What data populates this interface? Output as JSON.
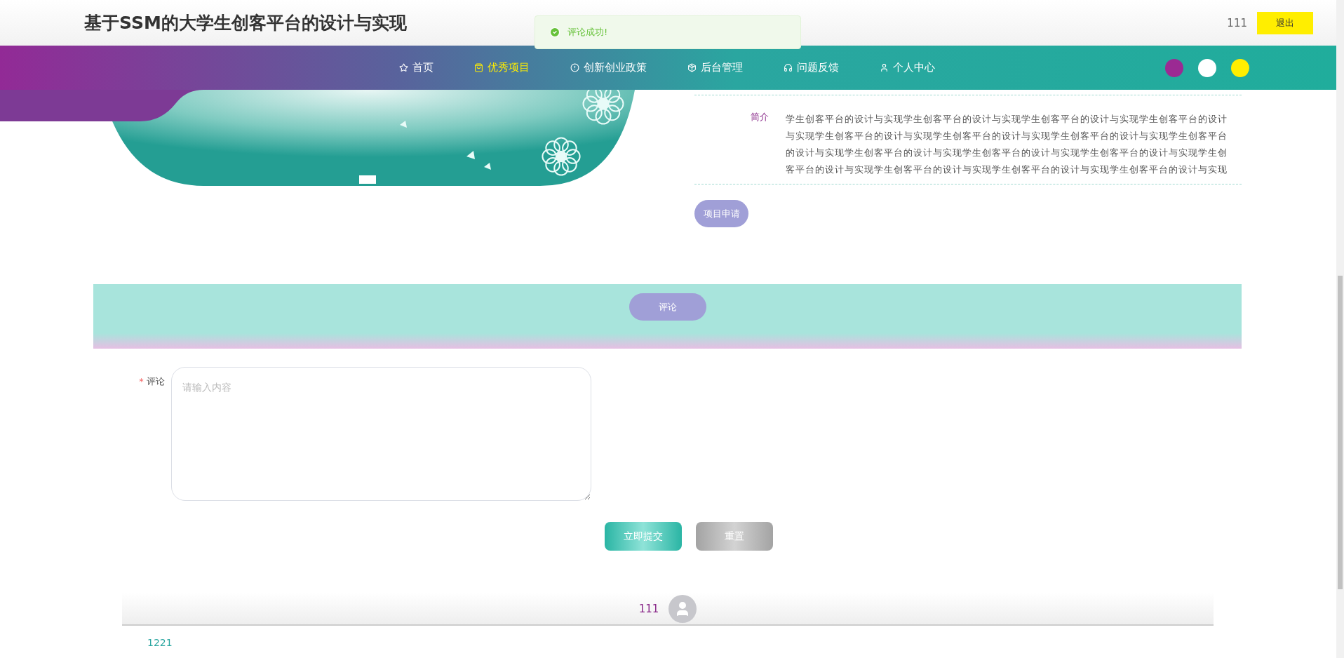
{
  "header": {
    "title": "基于SSM的大学生创客平台的设计与实现",
    "username": "111",
    "logout": "退出"
  },
  "toast": {
    "kind": "success",
    "message": "评论成功!"
  },
  "nav": {
    "items": [
      {
        "label": "首页",
        "selected": false
      },
      {
        "label": "优秀项目",
        "selected": true
      },
      {
        "label": "创新创业政策",
        "selected": false
      },
      {
        "label": "后台管理",
        "selected": false
      },
      {
        "label": "问题反馈",
        "selected": false
      },
      {
        "label": "个人中心",
        "selected": false
      }
    ]
  },
  "theme_dots": [
    {
      "color": "#9b2a93"
    },
    {
      "color": "#ffffff"
    },
    {
      "color": "#ffee00"
    }
  ],
  "project": {
    "fields": [
      {
        "label": "简介",
        "value": "学生创客平台的设计与实现学生创客平台的设计与实现学生创客平台的设计与实现学生创客平台的设计与实现学生创客平台的设计与实现学生创客平台的设计与实现学生创客平台的设计与实现学生创客平台的设计与实现学生创客平台的设计与实现学生创客平台的设计与实现学生创客平台的设计与实现学生创客平台的设计与实现学生创客平台的设计与实现学生创客平台的设计与实现学生创客平台的设计与实现"
      }
    ],
    "apply_button": "项目申请"
  },
  "comment_section": {
    "tab": "评论",
    "form": {
      "label": "评论",
      "required_mark": "*",
      "placeholder": "请输入内容"
    },
    "buttons": [
      {
        "kind": "submit",
        "label": "立即提交"
      },
      {
        "kind": "reset",
        "label": "重置"
      }
    ]
  },
  "comments": [
    {
      "user": "111",
      "text": "1221"
    }
  ]
}
